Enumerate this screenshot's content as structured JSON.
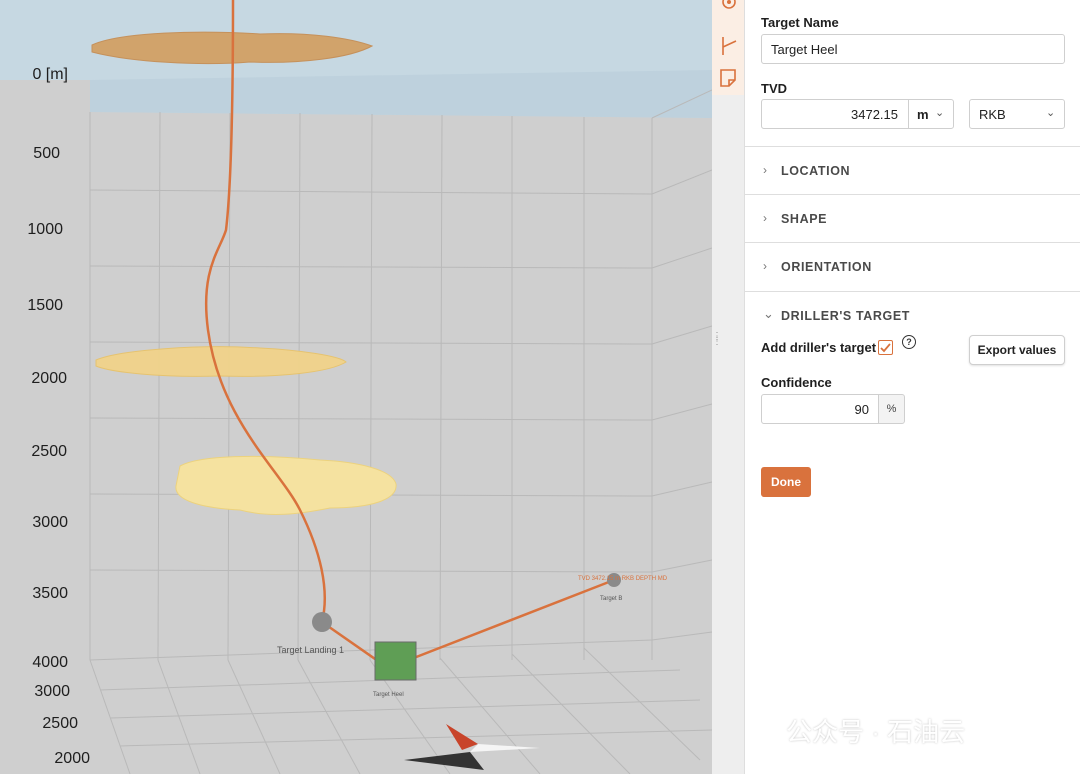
{
  "viewport": {
    "depth_axis": [
      "0 [m]",
      "500",
      "1000",
      "1500",
      "2000",
      "2500",
      "3000",
      "3500",
      "4000"
    ],
    "north_axis": [
      "3000",
      "2500",
      "2000"
    ],
    "targets": [
      {
        "label": "Target Landing 1"
      },
      {
        "label": "Target Heel"
      },
      {
        "label": "Target B"
      }
    ],
    "target_b_caption": "TVD 3472.15 m RKB DEPTH MD",
    "colors": {
      "well_path": "#d9723d",
      "formation_top": "#d49a57",
      "formation_mid": "#f1d38a",
      "formation_lower": "#f5e2a0",
      "water": "#c6d8e2",
      "target_heel": "#5f9e55"
    }
  },
  "toolbar": {
    "icons": [
      "map-pin-icon",
      "trajectory-icon",
      "note-icon"
    ]
  },
  "panel": {
    "target_name_label": "Target Name",
    "target_name_value": "Target Heel",
    "tvd_label": "TVD",
    "tvd_value": "3472.15",
    "tvd_unit": "m",
    "tvd_reference": "RKB",
    "sections": [
      {
        "title": "LOCATION",
        "expanded": false
      },
      {
        "title": "SHAPE",
        "expanded": false
      },
      {
        "title": "ORIENTATION",
        "expanded": false
      },
      {
        "title": "DRILLER'S TARGET",
        "expanded": true
      }
    ],
    "add_drillers_target_label": "Add driller's target",
    "add_drillers_target_checked": true,
    "help_icon": "?",
    "export_values_label": "Export values",
    "confidence_label": "Confidence",
    "confidence_value": "90",
    "confidence_unit": "%",
    "done_label": "Done",
    "accent_color": "#d9723d"
  },
  "watermark": "公众号 · 石油云"
}
